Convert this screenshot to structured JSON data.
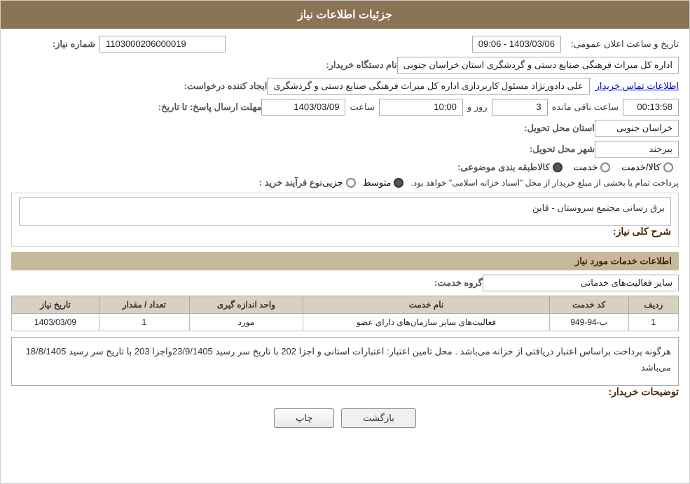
{
  "page": {
    "title": "جزئیات اطلاعات نیاز"
  },
  "header": {
    "announcement_label": "تاریخ و ساعت اعلان عمومی:",
    "announcement_value": "1403/03/06 - 09:06",
    "need_number_label": "شماره نیاز:",
    "need_number_value": "1103000206000019"
  },
  "buyer_org": {
    "label": "نام دستگاه خریدار:",
    "value": "اداره کل میراث فرهنگی  صنایع دستی و گردشگری استان خراسان جنوبی"
  },
  "requester": {
    "label": "ایجاد کننده درخواست:",
    "name": "علی دادورنژاد مسئول کاربردازی اداره کل میراث فرهنگی  صنایع دستی و گردشگری",
    "contact_link": "اطلاعات تماس خریدار"
  },
  "response_deadline": {
    "label": "مهلت ارسال پاسخ: تا تاریخ:",
    "date": "1403/03/09",
    "time_label": "ساعت",
    "time_value": "10:00",
    "day_label": "روز و",
    "day_value": "3",
    "remaining_label": "ساعت باقی مانده",
    "remaining_value": "00:13:58"
  },
  "delivery_province": {
    "label": "استان محل تحویل:",
    "value": "خراسان جنوبی"
  },
  "delivery_city": {
    "label": "شهر محل تحویل:",
    "value": "بیرجند"
  },
  "category": {
    "label": "طبقه بندی موضوعی:",
    "options": [
      {
        "label": "کالا",
        "selected": true
      },
      {
        "label": "خدمت",
        "selected": false
      },
      {
        "label": "کالا/خدمت",
        "selected": false
      }
    ]
  },
  "purchase_type": {
    "label": "نوع فرآیند خرید :",
    "options": [
      {
        "label": "جزیی",
        "selected": false
      },
      {
        "label": "متوسط",
        "selected": true
      }
    ],
    "note": "پرداخت تمام یا بخشی از مبلغ خریدار از محل \"اسناد خزانه اسلامی\" خواهد بود."
  },
  "general_description": {
    "section_title": "شرح کلی نیاز:",
    "value": "برق رسانی مجتمع سروستان - قاین"
  },
  "services_section": {
    "section_title": "اطلاعات خدمات مورد نیاز",
    "service_group_label": "گروه خدمت:",
    "service_group_value": "سایر فعالیت‌های خدماتی",
    "table": {
      "columns": [
        "ردیف",
        "کد خدمت",
        "نام خدمت",
        "واحد اندازه گیری",
        "تعداد / مقدار",
        "تاریخ نیاز"
      ],
      "rows": [
        {
          "row_num": "1",
          "code": "ب-94-949",
          "name": "فعالیت‌های سایر سازمان‌های دارای عضو",
          "unit": "مورد",
          "quantity": "1",
          "date": "1403/03/09"
        }
      ]
    }
  },
  "buyer_notes": {
    "section_title": "توضیحات خریدار:",
    "value": "هرگونه پرداخت براساس اعتبار دریافتی از خزانه می‌باشد . محل تامین اعتبار: اعتبارات استانی و اجزا 202  با تاریخ سر رسید 23/9/1405واجزا 203 با تاریخ سر رسید 18/8/1405 می‌باشد"
  },
  "buttons": {
    "back": "بازگشت",
    "print": "چاپ"
  }
}
